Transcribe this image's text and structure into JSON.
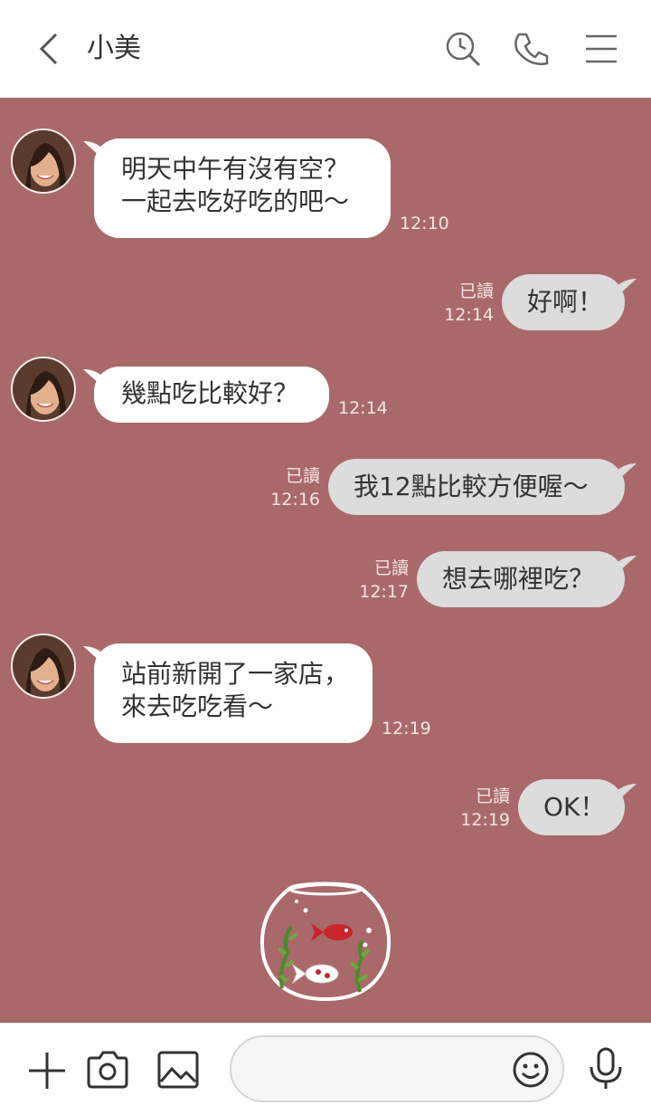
{
  "header": {
    "contact_name": "小美",
    "icons": [
      "back-chevron-icon",
      "search-history-icon",
      "phone-icon",
      "menu-icon"
    ]
  },
  "colors": {
    "background": "#a9696b",
    "incoming_bubble": "#ffffff",
    "outgoing_bubble": "#dcdcdc"
  },
  "messages": [
    {
      "side": "in",
      "text": "明天中午有沒有空？\n一起去吃好吃的吧～",
      "time": "12:10"
    },
    {
      "side": "out",
      "text": "好啊！",
      "read": "已讀",
      "time": "12:14"
    },
    {
      "side": "in",
      "text": "幾點吃比較好？",
      "time": "12:14"
    },
    {
      "side": "out",
      "text": "我12點比較方便喔～",
      "read": "已讀",
      "time": "12:16"
    },
    {
      "side": "out",
      "text": "想去哪裡吃？",
      "read": "已讀",
      "time": "12:17"
    },
    {
      "side": "in",
      "text": "站前新開了一家店，\n來去吃吃看～",
      "time": "12:19"
    },
    {
      "side": "out",
      "text": "OK！",
      "read": "已讀",
      "time": "12:19"
    }
  ],
  "input_bar": {
    "placeholder": "",
    "icons": [
      "plus-icon",
      "camera-icon",
      "image-icon",
      "emoji-icon",
      "microphone-icon"
    ]
  }
}
